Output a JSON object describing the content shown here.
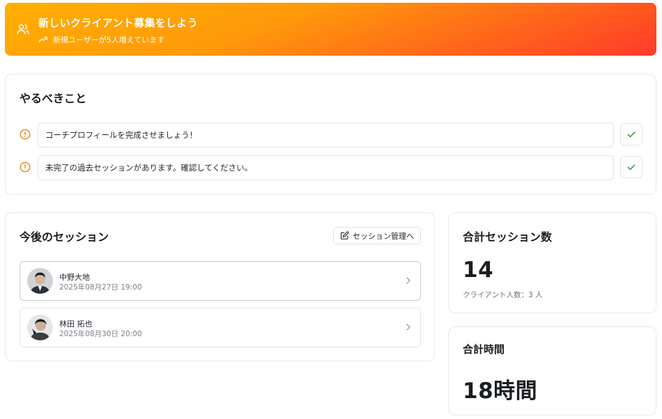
{
  "banner": {
    "title": "新しいクライアント募集をしよう",
    "subtitle": "新規ユーザーが5人増えています",
    "icon": "users-icon",
    "trend_icon": "trending-up-icon"
  },
  "todo": {
    "title": "やるべきこと",
    "items": [
      {
        "text": "コーチプロフィールを完成させましょう！"
      },
      {
        "text": "未完了の過去セッションがあります。確認してください。"
      }
    ]
  },
  "sessions": {
    "title": "今後のセッション",
    "manage_label": "セッション管理へ",
    "items": [
      {
        "name": "中野大地",
        "datetime": "2025年08月27日 19:00"
      },
      {
        "name": "林田 拓也",
        "datetime": "2025年08月30日 20:00"
      }
    ]
  },
  "stats": {
    "total_sessions": {
      "title": "合計セッション数",
      "value": "14",
      "sub": "クライアント人数：3 人"
    },
    "total_time": {
      "title": "合計時間",
      "value": "18時間"
    }
  },
  "colors": {
    "accent_warn": "#e8891a",
    "check_green": "#2e9a4a",
    "banner_start": "#ffb000",
    "banner_end": "#ff3a2a"
  }
}
